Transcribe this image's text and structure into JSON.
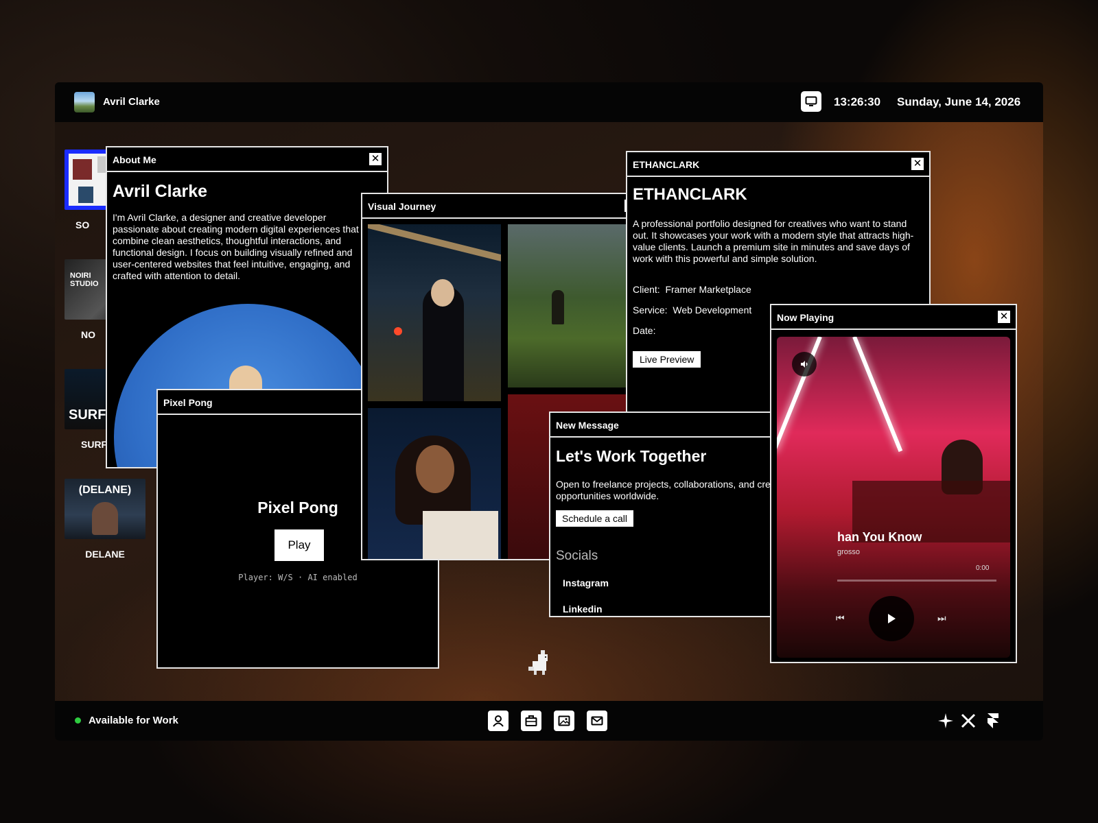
{
  "topbar": {
    "name": "Avril Clarke",
    "time": "13:26:30",
    "date": "Sunday, June 14, 2026"
  },
  "desktop_icons": [
    {
      "label": "SO"
    },
    {
      "label": "NO",
      "thumb_text": "NOIRI STUDIO"
    },
    {
      "label": "SURF",
      "thumb_text": "SURF"
    },
    {
      "label": "DELANE",
      "thumb_text": "(DELANE)"
    }
  ],
  "about": {
    "window_title": "About Me",
    "heading": "Avril Clarke",
    "body": "I'm Avril Clarke, a designer and creative developer passionate about creating modern digital experiences that combine clean aesthetics, thoughtful interactions, and functional design. I focus on building visually refined and user-centered websites that feel intuitive, engaging, and crafted with attention to detail."
  },
  "pong": {
    "window_title": "Pixel Pong",
    "game_title": "Pixel Pong",
    "play_label": "Play",
    "hint": "Player: W/S · AI enabled"
  },
  "journey": {
    "window_title": "Visual Journey"
  },
  "project": {
    "window_title": "ETHANCLARK",
    "heading": "ETHANCLARK",
    "description": "A professional portfolio designed for creatives who want to stand out. It showcases your work with a modern style that attracts high-value clients. Launch a premium site in minutes and save days of work with this powerful and simple solution.",
    "client_label": "Client:",
    "client_value": "Framer Marketplace",
    "service_label": "Service:",
    "service_value": "Web Development",
    "date_label": "Date:",
    "preview_label": "Live Preview"
  },
  "message": {
    "window_title": "New Message",
    "heading": "Let's Work Together",
    "body": "Open to freelance projects, collaborations, and creative opportunities worldwide.",
    "cta_label": "Schedule a call",
    "socials_heading": "Socials",
    "socials": [
      "Instagram",
      "Linkedin"
    ]
  },
  "player": {
    "window_title": "Now Playing",
    "track_title": "han You Know",
    "artist": "grosso",
    "elapsed": "0:00",
    "progress": 0.0
  },
  "bottombar": {
    "status": "Available for Work",
    "status_color": "#2ecc40"
  },
  "dock": [
    "user-icon",
    "briefcase-icon",
    "gallery-icon",
    "mail-icon"
  ],
  "socials_bar": [
    "sparkle-icon",
    "x-logo-icon",
    "framer-logo-icon"
  ]
}
